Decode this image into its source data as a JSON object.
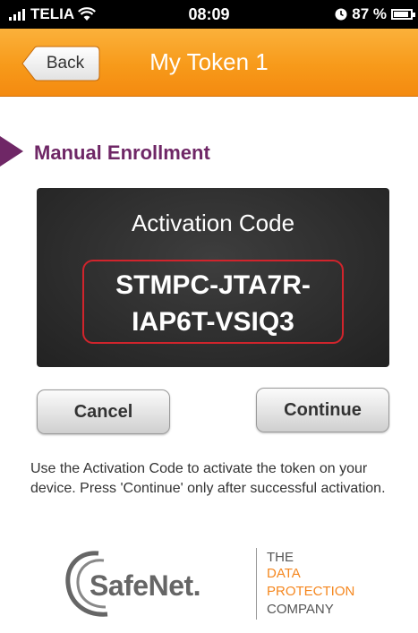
{
  "status_bar": {
    "carrier": "TELIA",
    "time": "08:09",
    "battery": "87 %",
    "icons": [
      "signal-bars-icon",
      "wifi-icon",
      "alarm-clock-icon",
      "battery-icon"
    ]
  },
  "nav": {
    "back_label": "Back",
    "title": "My Token 1"
  },
  "section": {
    "title": "Manual Enrollment"
  },
  "activation": {
    "label": "Activation Code",
    "code_line1": "STMPC-JTA7R-",
    "code_line2": "IAP6T-VSIQ3"
  },
  "buttons": {
    "cancel": "Cancel",
    "continue": "Continue"
  },
  "help_text": "Use the Activation Code to activate the token on your device. Press 'Continue' only after successful activation.",
  "brand": {
    "logo_text": "SafeNet.",
    "tagline": [
      "THE",
      "DATA",
      "PROTECTION",
      "COMPANY"
    ]
  },
  "colors": {
    "nav_orange": "#f79a1a",
    "section_purple": "#6f2766",
    "code_border_red": "#d1242c",
    "panel_dark": "#2e2e2e",
    "tagline_orange": "#f5871f"
  }
}
